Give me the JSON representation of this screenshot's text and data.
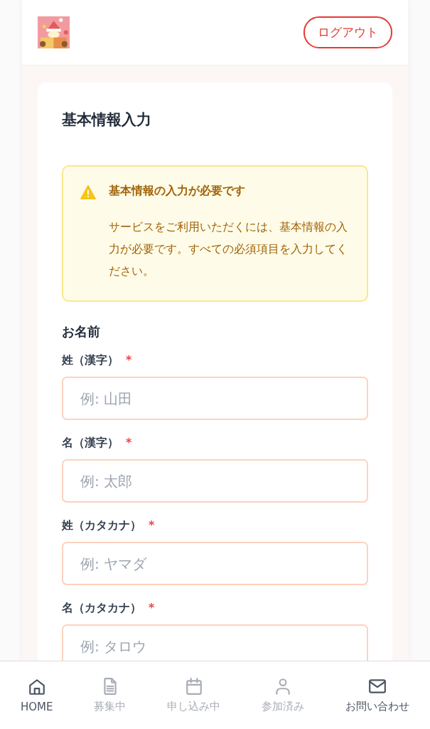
{
  "header": {
    "logout_button": "ログアウト"
  },
  "form": {
    "title": "基本情報入力",
    "alert": {
      "title": "基本情報の入力が必要です",
      "message": "サービスをご利用いただくには、基本情報の入力が必要です。すべての必須項目を入力してください。"
    },
    "section": "お名前",
    "fields": [
      {
        "label": "姓（漢字）",
        "required": true,
        "placeholder": "例: 山田"
      },
      {
        "label": "名（漢字）",
        "required": true,
        "placeholder": "例: 太郎"
      },
      {
        "label": "姓（カタカナ）",
        "required": true,
        "placeholder": "例: ヤマダ"
      },
      {
        "label": "名（カタカナ）",
        "required": true,
        "placeholder": "例: タロウ"
      }
    ],
    "required_mark": "*"
  },
  "bottom_nav": [
    {
      "kind": "home",
      "label": "HOME",
      "disabled": false
    },
    {
      "kind": "document",
      "label": "募集中",
      "disabled": true
    },
    {
      "kind": "calendar",
      "label": "申し込み中",
      "disabled": true
    },
    {
      "kind": "person",
      "label": "参加済み",
      "disabled": true
    },
    {
      "kind": "mail",
      "label": "お問い合わせ",
      "disabled": false
    }
  ]
}
